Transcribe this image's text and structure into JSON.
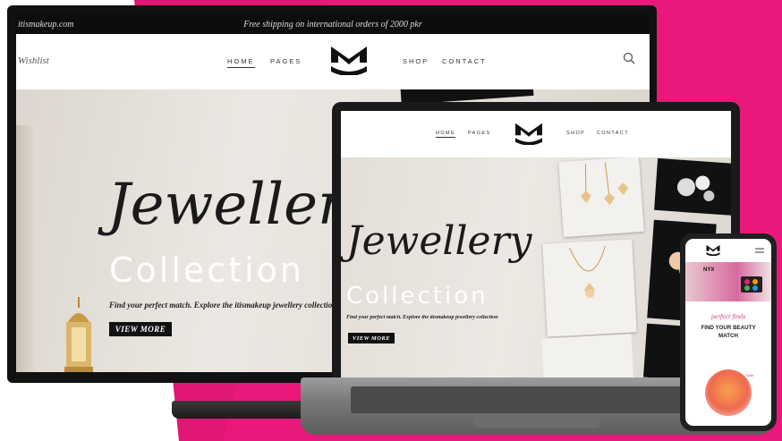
{
  "theme": {
    "accent": "#e91e7a",
    "dark": "#111111",
    "hero_bg": "#e6e1db"
  },
  "monitor": {
    "site_url": "itismakeup.com",
    "promo": "Free shipping on international orders of 2000 pkr",
    "wishlist": "Wishlist",
    "nav": {
      "home": "HOME",
      "pages": "PAGES",
      "shop": "SHOP",
      "contact": "CONTACT"
    },
    "hero": {
      "script_title": "Jewellery",
      "collection": "Collection",
      "tagline": "Find your perfect match. Explore the itismakeup jewellery collection",
      "cta": "VIEW MORE"
    }
  },
  "laptop": {
    "nav": {
      "home": "HOME",
      "pages": "PAGES",
      "shop": "SHOP",
      "contact": "CONTACT"
    },
    "hero": {
      "script_title": "Jewellery",
      "collection": "Collection",
      "tagline": "Find your perfect match. Explore the itismakeup jewellery collection",
      "cta": "VIEW MORE"
    }
  },
  "phone": {
    "banner_brand": "NYX",
    "script": "perfect finds",
    "title_line1": "FIND YOUR BEAUTY",
    "title_line2": "MATCH",
    "product_badge": "Sale"
  },
  "icons": [
    "logo-mark",
    "search-icon",
    "menu-icon"
  ]
}
